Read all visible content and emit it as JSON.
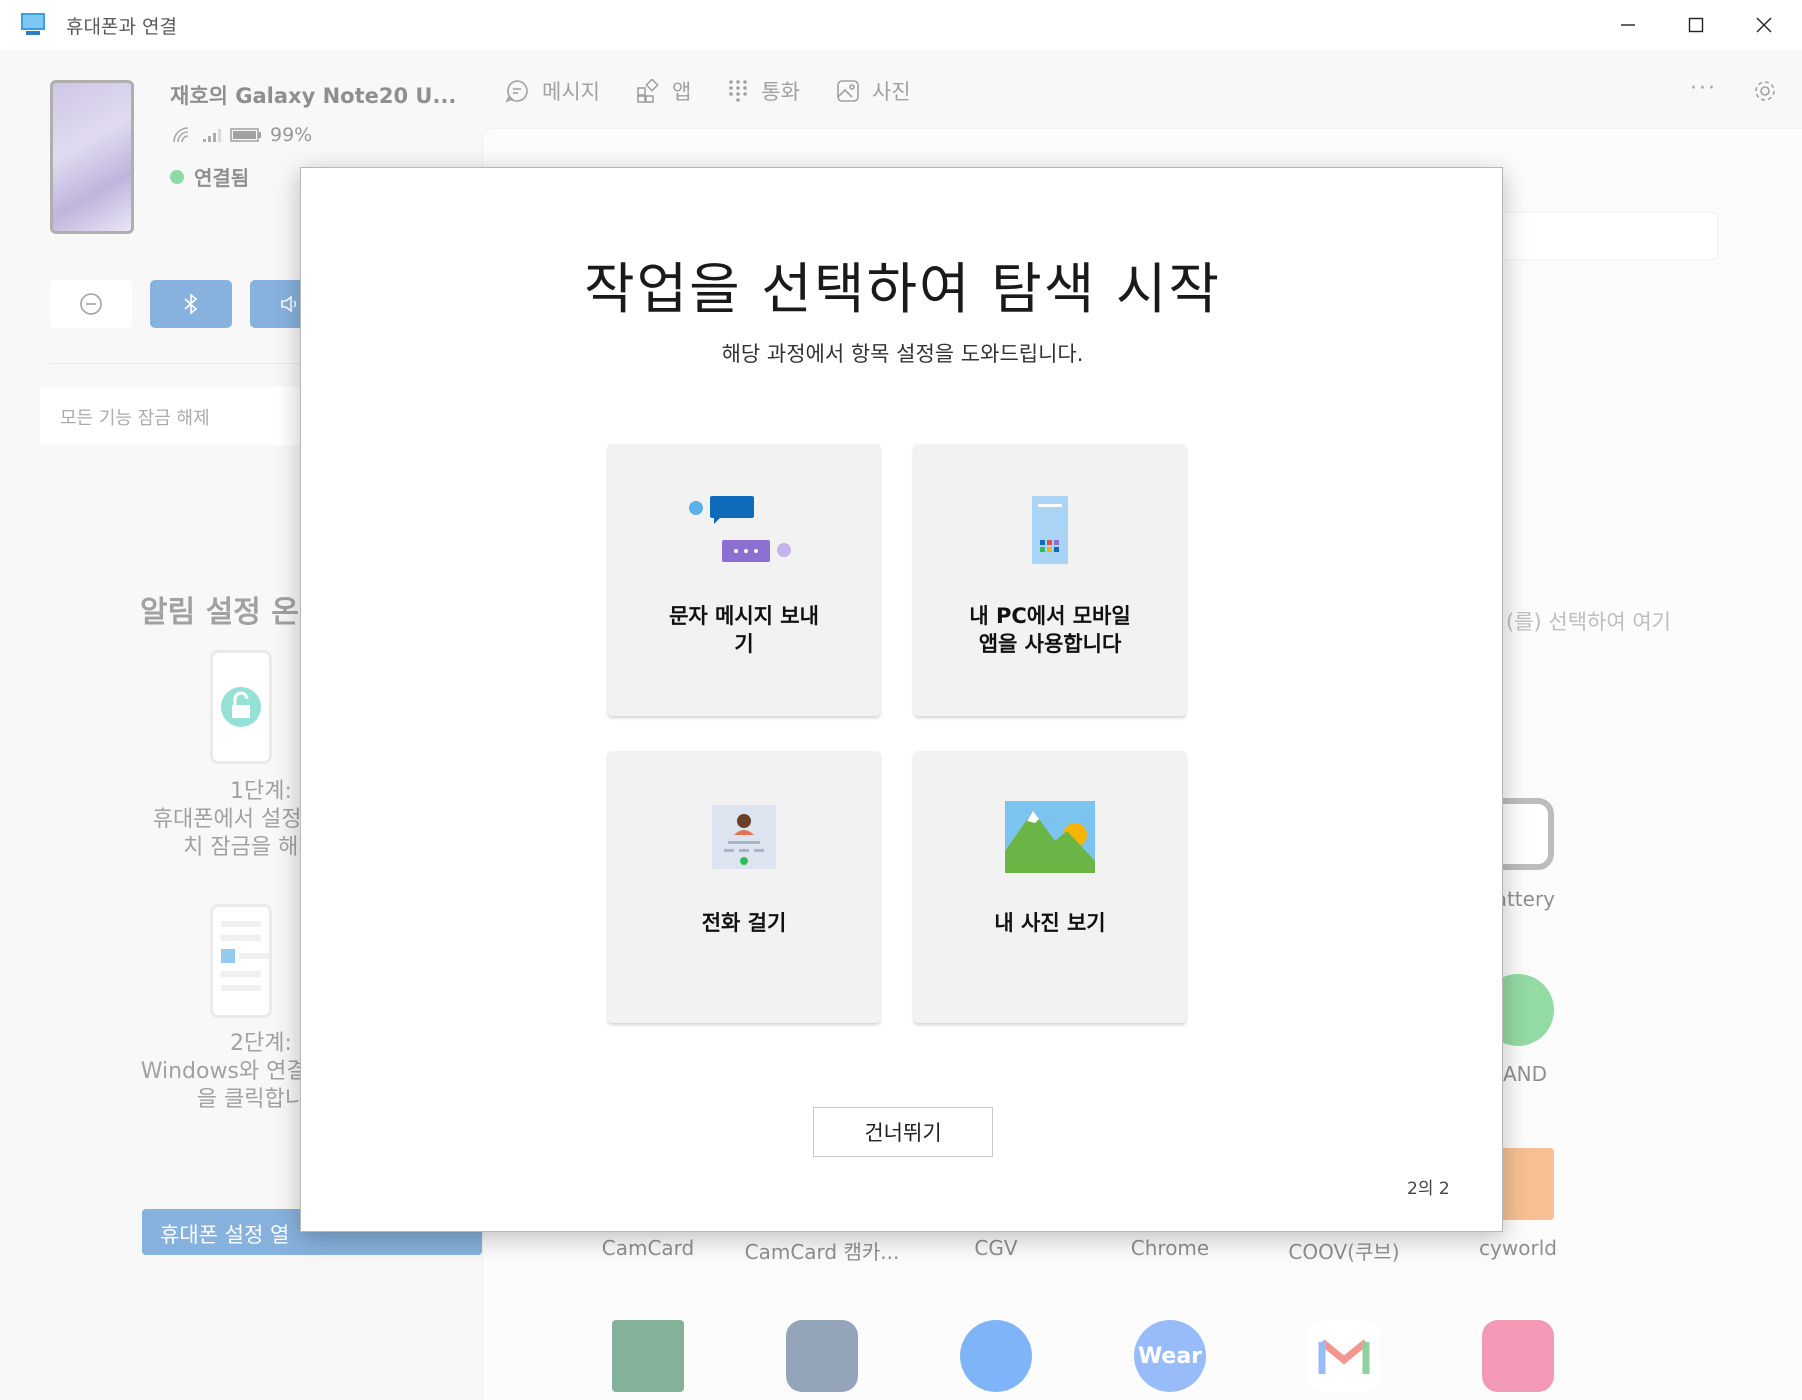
{
  "window": {
    "title": "휴대폰과 연결",
    "controls": [
      "minimize",
      "maximize",
      "close"
    ]
  },
  "device": {
    "name": "재호의 Galaxy Note20 U...",
    "battery": "99%",
    "status": "연결됨",
    "status_color": "#2ebd59"
  },
  "quick_actions": [
    "do-not-disturb-icon",
    "bluetooth-icon",
    "volume-icon"
  ],
  "sidebar": {
    "unlock_label": "모든 기능 잠금 해제",
    "notif_heading": "알림 설정 온",
    "step1_title": "1단계:",
    "step1_line1": "휴대폰에서 설정 열기를",
    "step1_line2": "치 잠금을 해제합",
    "step2_title": "2단계:",
    "step2_line1": "Windows와 연결 앱을 설",
    "step2_line2": "을 클릭합니다",
    "open_settings_label": "휴대폰 설정 열"
  },
  "nav": {
    "tabs": [
      {
        "label": "메시지",
        "icon": "message-icon"
      },
      {
        "label": "앱",
        "icon": "apps-icon"
      },
      {
        "label": "통화",
        "icon": "dialpad-icon"
      },
      {
        "label": "사진",
        "icon": "photo-icon"
      }
    ]
  },
  "apps_pane": {
    "hint": "(를) 선택하여 여기",
    "row_labels": [
      "Battery",
      "AND",
      "CamCard",
      "CamCard 캠카...",
      "CGV",
      "Chrome",
      "COOV(쿠브)",
      "cyworld"
    ],
    "bottom_icons": [
      "excel-icon",
      "android-icon",
      "facebook-icon",
      "wear-icon",
      "gmail-icon",
      "gallery-icon"
    ],
    "wear_text": "Wear"
  },
  "dialog": {
    "title": "작업을 선택하여 탐색 시작",
    "subtitle": "해당 과정에서 항목 설정을 도와드립니다.",
    "cards": [
      {
        "line1": "문자 메시지 보내",
        "line2": "기"
      },
      {
        "line1": "내 PC에서 모바일",
        "line2": "앱을 사용합니다"
      },
      {
        "line1": "전화 걸기",
        "line2": ""
      },
      {
        "line1": "내 사진 보기",
        "line2": ""
      }
    ],
    "skip_label": "건너뛰기",
    "page_indicator": "2의 2"
  },
  "colors": {
    "accent": "#2673c4",
    "message_blue": "#0f6cbd",
    "message_purple": "#8c6fd0"
  }
}
